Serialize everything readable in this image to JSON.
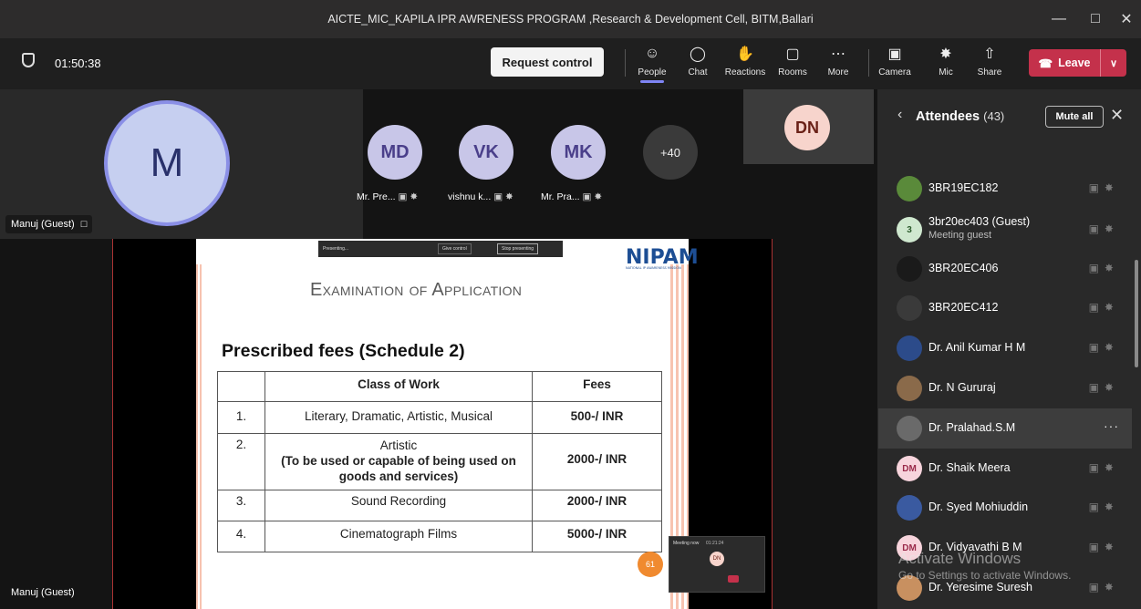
{
  "window": {
    "title": "AICTE_MIC_KAPILA IPR AWRENESS PROGRAM ,Research & Development Cell, BITM,Ballari"
  },
  "meeting": {
    "timer": "01:50:38",
    "request_control": "Request control",
    "toolbar": {
      "people": "People",
      "chat": "Chat",
      "reactions": "Reactions",
      "rooms": "Rooms",
      "more": "More",
      "camera": "Camera",
      "mic": "Mic",
      "share": "Share",
      "leave": "Leave"
    }
  },
  "stage": {
    "self_initial": "M",
    "self_label": "Manuj (Guest)",
    "bottom_label": "Manuj (Guest)",
    "participants": [
      {
        "initials": "MD",
        "name": "Mr. Pre...",
        "bg": "#c8c6e8",
        "fg": "#4a3f8a"
      },
      {
        "initials": "VK",
        "name": "vishnu k...",
        "bg": "#c8c6e8",
        "fg": "#4a3f8a"
      },
      {
        "initials": "MK",
        "name": "Mr. Pra...",
        "bg": "#c8c6e8",
        "fg": "#4a3f8a"
      }
    ],
    "overflow": "+40",
    "dn_initials": "DN"
  },
  "slide": {
    "presenting_text": "Presenting...",
    "give_control": "Give control",
    "stop_presenting": "Stop presenting",
    "logo": "NIPAM",
    "logo_sub": "NATIONAL IP AWARENESS MISSION",
    "title": "Examination of Application",
    "subtitle": "Prescribed fees (Schedule 2)",
    "table_header": {
      "class": "Class of Work",
      "fees": "Fees"
    },
    "rows": [
      {
        "no": "1.",
        "work": "Literary, Dramatic, Artistic, Musical",
        "work_sub": "",
        "fee": "500-/ INR"
      },
      {
        "no": "2.",
        "work": "Artistic",
        "work_sub": "(To be used or capable of being used on goods and services)",
        "fee": "2000-/ INR"
      },
      {
        "no": "3.",
        "work": "Sound Recording",
        "work_sub": "",
        "fee": "2000-/ INR"
      },
      {
        "no": "4.",
        "work": "Cinematograph Films",
        "work_sub": "",
        "fee": "5000-/ INR"
      }
    ],
    "mini_label": "Meeting now",
    "mini_time": "01:21:24",
    "mini_initials": "DN",
    "badge": "61"
  },
  "attendees": {
    "title": "Attendees",
    "count": "(43)",
    "mute_all": "Mute all",
    "list": [
      {
        "name": "3BR19EC182",
        "sub": "",
        "initials": "",
        "bg": "#5a8a3a"
      },
      {
        "name": "3br20ec403 (Guest)",
        "sub": "Meeting guest",
        "initials": "3",
        "bg": "#cfe8cf"
      },
      {
        "name": "3BR20EC406",
        "sub": "",
        "initials": "",
        "bg": "#1a1a1a"
      },
      {
        "name": "3BR20EC412",
        "sub": "",
        "initials": "",
        "bg": "#3a3a3a"
      },
      {
        "name": "Dr. Anil Kumar H M",
        "sub": "",
        "initials": "",
        "bg": "#2c4b8a"
      },
      {
        "name": "Dr. N Gururaj",
        "sub": "",
        "initials": "",
        "bg": "#8a6a4a"
      },
      {
        "name": "Dr. Pralahad.S.M",
        "sub": "",
        "initials": "",
        "bg": "#6a6a6a"
      },
      {
        "name": "Dr. Shaik Meera",
        "sub": "",
        "initials": "DM",
        "bg": "#f7d4dc"
      },
      {
        "name": "Dr. Syed Mohiuddin",
        "sub": "",
        "initials": "",
        "bg": "#3a5aa0"
      },
      {
        "name": "Dr. Vidyavathi B M",
        "sub": "",
        "initials": "DM",
        "bg": "#f7d4dc"
      },
      {
        "name": "Dr. Yeresime Suresh",
        "sub": "",
        "initials": "",
        "bg": "#c89060"
      }
    ],
    "row_more": "···"
  },
  "watermark": {
    "line1": "Activate Windows",
    "line2": "Go to Settings to activate Windows."
  }
}
